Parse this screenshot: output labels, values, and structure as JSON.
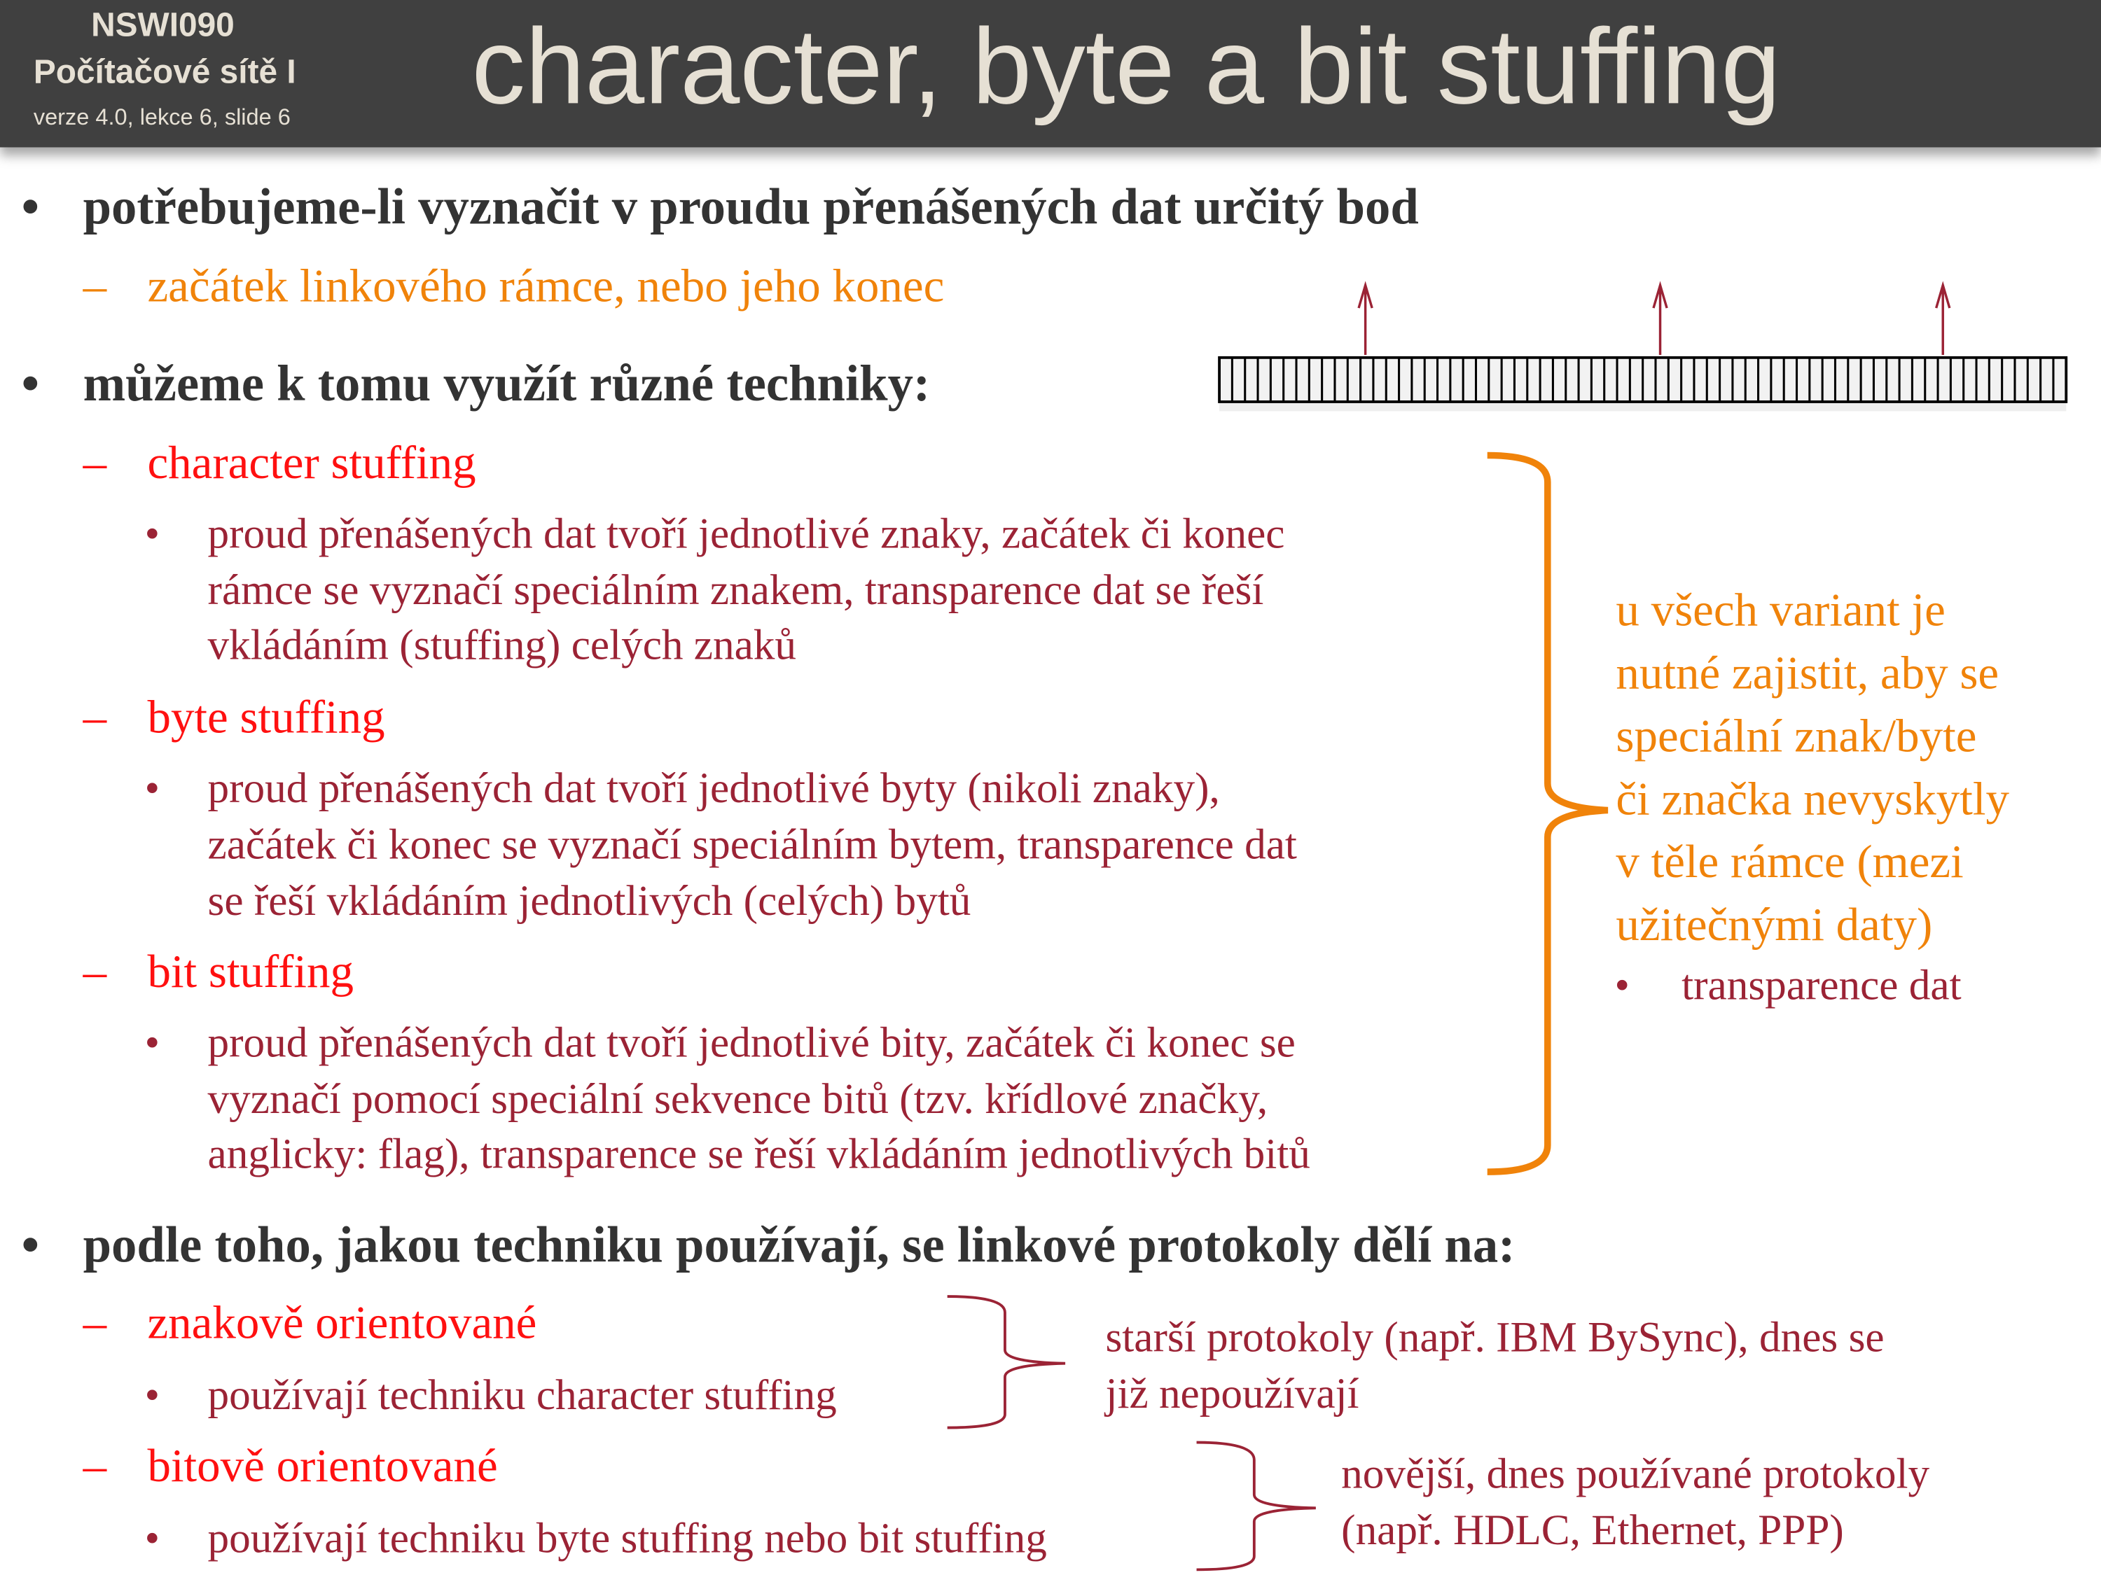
{
  "header": {
    "course_code": "NSWI090",
    "course_name": "Počítačové sítě I",
    "version": "verze 4.0, lekce  6, slide 6",
    "title": "character, byte a bit stuffing"
  },
  "colors": {
    "header_bg": "#404040",
    "header_text": "#e6e0d4",
    "text": "#333333",
    "orange": "#f0830a",
    "red": "#ff1010",
    "dark_red": "#9b2335"
  },
  "bullets": {
    "b1": "potřebujeme-li vyznačit v proudu přenášených dat určitý bod",
    "b1_sub": "začátek linkového rámce, nebo jeho konec",
    "b2": "můžeme k tomu využít různé techniky:",
    "char_title": "character stuffing",
    "char_lines": [
      "proud přenášených dat tvoří jednotlivé znaky, začátek či konec",
      "rámce se vyznačí speciálním znakem, transparence dat se řeší",
      "vkládáním (stuffing) celých znaků"
    ],
    "byte_title": "byte stuffing",
    "byte_lines": [
      "proud přenášených dat tvoří jednotlivé byty (nikoli znaky),",
      "začátek či konec se vyznačí speciálním bytem, transparence dat",
      "se řeší vkládáním jednotlivých (celých) bytů"
    ],
    "bit_title": "bit stuffing",
    "bit_lines": [
      "proud přenášených dat tvoří jednotlivé bity, začátek či konec se",
      "vyznačí pomocí speciální sekvence bitů (tzv. křídlové značky,",
      "anglicky: flag), transparence se řeší vkládáním jednotlivých bitů"
    ],
    "b3": "podle toho, jakou techniku používají, se linkové protokoly dělí na:",
    "char_oriented": "znakově orientované",
    "char_oriented_sub": "používají techniku character stuffing",
    "bit_oriented": "bitově orientované",
    "bit_oriented_sub": "používají techniku byte stuffing nebo bit stuffing"
  },
  "side_note": {
    "lines": [
      "u všech variant je",
      "nutné zajistit, aby se",
      "speciální znak/byte",
      "či značka nevyskytly",
      "v těle rámce (mezi",
      "užitečnými daty)"
    ],
    "bullet": "transparence dat"
  },
  "brace_notes": {
    "old": [
      "starší protokoly (např. IBM BySync), dnes se",
      "již nepoužívají"
    ],
    "new": [
      "novější, dnes používané protokoly",
      "(např. HDLC, Ethernet, PPP)"
    ]
  },
  "symbols": {
    "bullet": "•",
    "dash": "–"
  }
}
